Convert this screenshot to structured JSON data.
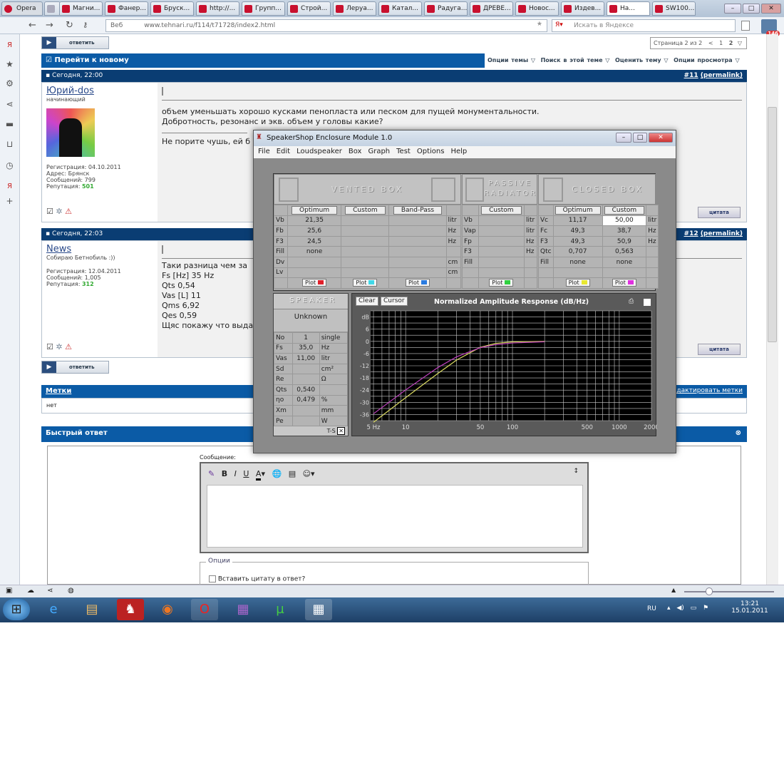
{
  "browser": {
    "app_label": "Opera",
    "tabs": [
      "",
      "Магни...",
      "Фанер...",
      "Бруск...",
      "http://...",
      "Групп...",
      "Строй...",
      "Леруа...",
      "Катал...",
      "Радуга...",
      "ДРЕВЕ...",
      "Новос...",
      "Издев...",
      "На...",
      "SW100..."
    ],
    "active_tab": 13,
    "address_prefix": "Веб",
    "url": "www.tehnari.ru/f114/t71728/index2.html",
    "search_placeholder": "Искать в Яндексе",
    "badge": "146"
  },
  "forum": {
    "reply_label": "ответить",
    "pager": {
      "text": "Страница 2 из 2",
      "prev": "<",
      "pages": [
        "1",
        "2"
      ]
    },
    "goto_new": "Перейти к новому",
    "options": [
      "Опции темы",
      "Поиск в этой теме",
      "Оценить тему",
      "Опции просмотра"
    ],
    "posts": [
      {
        "date": "Сегодня, 22:00",
        "num": "#11",
        "permalink": "(permalink)",
        "user": "Юрий-dos",
        "rank": "начинающий",
        "info": [
          "Регистрация: 04.10.2011",
          "Адрес: Брянск",
          "Сообщений: 799"
        ],
        "rep_label": "Репутация:",
        "rep": "501",
        "text": "объем уменьшать хорошо кусками пенопласта или песком для пущей монументальности.\nДобротность, резонанс и экв. объем у головы какие?",
        "sig": "Не порите чушь, ей б",
        "quote": "цитата"
      },
      {
        "date": "Сегодня, 22:03",
        "num": "#12",
        "permalink": "(permalink)",
        "user": "News",
        "rank": "Собираю Бетнобиль :))",
        "info": [
          "Регистрация: 12.04.2011",
          "Сообщений: 1,005"
        ],
        "rep_label": "Репутация:",
        "rep": "312",
        "text": "Таки разница чем за\nFs [Hz] 35 Hz\nQts 0,54\nVas [L] 11\nQms 6,92\nQes 0,59\nЩяс покажу что выда",
        "quote": "цитата"
      }
    ],
    "tags_title": "Метки",
    "tags_value": "нет",
    "edit_tags": "Редактировать метки",
    "quick_reply": "Быстрый ответ",
    "message_label": "Сообщение:",
    "options_legend": "Опции",
    "insert_quote": "Вставить цитату в ответ?"
  },
  "speakershop": {
    "title": "SpeakerShop Enclosure Module 1.0",
    "menu": [
      "File",
      "Edit",
      "Loudspeaker",
      "Box",
      "Graph",
      "Test",
      "Options",
      "Help"
    ],
    "vented": {
      "title": "VENTED BOX",
      "buttons": [
        "Optimum",
        "Custom",
        "Band-Pass"
      ],
      "rows": [
        [
          "Vb",
          "21,35",
          "",
          "",
          "litr"
        ],
        [
          "Fb",
          "25,6",
          "",
          "",
          "Hz"
        ],
        [
          "F3",
          "24,5",
          "",
          "",
          "Hz"
        ],
        [
          "Fill",
          "none",
          "",
          "",
          ""
        ],
        [
          "Dv",
          "",
          "",
          "",
          "cm"
        ],
        [
          "Lv",
          "",
          "",
          "",
          "cm"
        ]
      ],
      "plot_colors": [
        "#e0202a",
        "#40d8e8",
        "#2a7be0"
      ]
    },
    "passive": {
      "title": "PASSIVE RADIATOR",
      "buttons": [
        "Custom"
      ],
      "rows": [
        [
          "Vb",
          "",
          "litr"
        ],
        [
          "Vap",
          "",
          "litr"
        ],
        [
          "Fp",
          "",
          "Hz"
        ],
        [
          "F3",
          "",
          "Hz"
        ],
        [
          "Fill",
          "",
          ""
        ],
        [
          "",
          "",
          ""
        ]
      ],
      "plot_colors": [
        "#30d040"
      ]
    },
    "closed": {
      "title": "CLOSED BOX",
      "buttons": [
        "Optimum",
        "Custom"
      ],
      "rows": [
        [
          "Vc",
          "11,17",
          "50,00",
          "litr"
        ],
        [
          "Fc",
          "49,3",
          "38,7",
          "Hz"
        ],
        [
          "F3",
          "49,3",
          "50,9",
          "Hz"
        ],
        [
          "Qtc",
          "0,707",
          "0,563",
          ""
        ],
        [
          "Fill",
          "none",
          "none",
          ""
        ],
        [
          "",
          "",
          "",
          ""
        ]
      ],
      "plot_colors": [
        "#e8e830",
        "#e030e0"
      ]
    },
    "plot_label": "Plot",
    "speaker": {
      "title": "SPEAKER",
      "name": "Unknown",
      "rows": [
        [
          "No",
          "1",
          "single"
        ],
        [
          "Fs",
          "35,0",
          "Hz"
        ],
        [
          "Vas",
          "11,00",
          "litr"
        ],
        [
          "Sd",
          "",
          "cm²"
        ],
        [
          "Re",
          "",
          "Ω"
        ],
        [
          "Qts",
          "0,540",
          ""
        ],
        [
          "ηo",
          "0,479",
          "%"
        ],
        [
          "Xm",
          "",
          "mm"
        ],
        [
          "Pe",
          "",
          "W"
        ]
      ],
      "ts_label": "T-S",
      "ts_checked": true
    },
    "graph_buttons": [
      "Clear",
      "Cursor"
    ]
  },
  "chart_data": {
    "type": "line",
    "title": "Normalized Amplitude Response (dB/Hz)",
    "ylabel": "dB",
    "x_scale": "log",
    "xlim": [
      4.7,
      2000
    ],
    "ylim": [
      -39,
      15
    ],
    "x_ticks": [
      {
        "v": 5,
        "label": "5 Hz"
      },
      {
        "v": 10,
        "label": "10"
      },
      {
        "v": 50,
        "label": "50"
      },
      {
        "v": 100,
        "label": "100"
      },
      {
        "v": 500,
        "label": "500"
      },
      {
        "v": 1000,
        "label": "1000"
      },
      {
        "v": 2000,
        "label": "2000"
      }
    ],
    "y_ticks": [
      6,
      0,
      -6,
      -12,
      -18,
      -24,
      -30,
      -36
    ],
    "grid": true,
    "background": "#000000",
    "series": [
      {
        "color": "#d8d860",
        "x": [
          5,
          10,
          20,
          30,
          50,
          70,
          100,
          200
        ],
        "y": [
          -39.8,
          -27.7,
          -15.8,
          -9.2,
          -2.9,
          -1.0,
          -0.25,
          0
        ]
      },
      {
        "color": "#c040c0",
        "x": [
          5,
          10,
          20,
          30,
          50,
          70,
          100,
          200
        ],
        "y": [
          -35.6,
          -23.9,
          -12.9,
          -7.6,
          -3.1,
          -1.6,
          -0.8,
          -0.2
        ]
      }
    ]
  },
  "taskbar": {
    "lang": "RU",
    "time": "13:21",
    "date": "15.01.2011"
  }
}
